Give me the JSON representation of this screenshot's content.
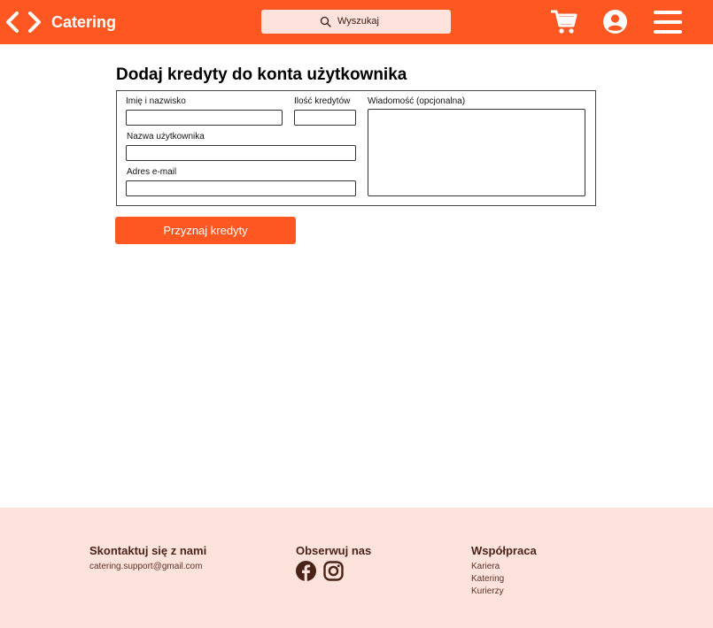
{
  "header": {
    "brand": "Catering",
    "search_placeholder": "Wyszukaj",
    "icons": [
      "back-arrow-icon",
      "forward-arrow-icon",
      "search-icon",
      "cart-icon",
      "user-icon",
      "menu-icon"
    ]
  },
  "main": {
    "title": "Dodaj kredyty do konta użytkownika",
    "fields": {
      "name_label": "Imię i nazwisko",
      "credits_label": "Ilość kredytów",
      "username_label": "Nazwa użytkownika",
      "email_label": "Adres e-mail",
      "message_label": "Wiadomość (opcjonalna)"
    },
    "values": {
      "name": "",
      "credits": "",
      "username": "",
      "email": "",
      "message": ""
    },
    "submit_label": "Przyznaj kredyty"
  },
  "footer": {
    "contact_heading": "Skontaktuj się z nami",
    "contact_email": "catering.support@gmail.com",
    "follow_heading": "Obserwuj nas",
    "social_icons": [
      "facebook-icon",
      "instagram-icon"
    ],
    "cooperation_heading": "Współpraca",
    "cooperation_links": [
      "Kariera",
      "Katering",
      "Kurierzy"
    ]
  },
  "colors": {
    "accent": "#ff5722",
    "footer_bg": "#fde3dc",
    "search_bg": "#fde3dc",
    "footer_text": "#4a2318"
  }
}
